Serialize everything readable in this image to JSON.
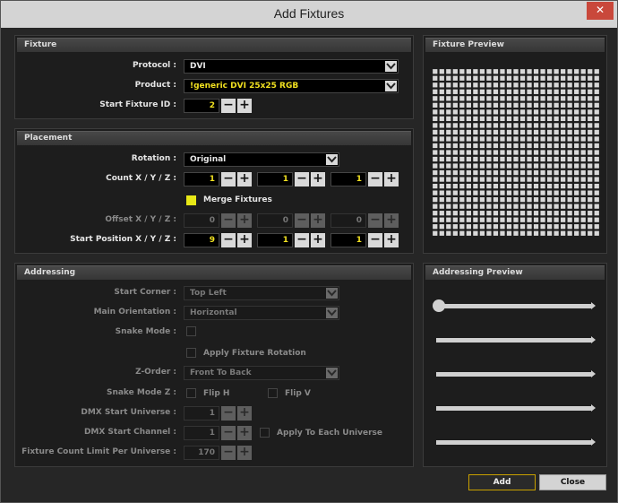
{
  "window": {
    "title": "Add Fixtures",
    "close_glyph": "✕"
  },
  "fixture": {
    "header": "Fixture",
    "protocol_label": "Protocol :",
    "protocol_value": "DVI",
    "product_label": "Product :",
    "product_value": "!generic DVI 25x25 RGB",
    "start_id_label": "Start Fixture ID :",
    "start_id_value": "2"
  },
  "placement": {
    "header": "Placement",
    "rotation_label": "Rotation :",
    "rotation_value": "Original",
    "count_label": "Count X / Y / Z :",
    "count": [
      "1",
      "1",
      "1"
    ],
    "merge_label": "Merge Fixtures",
    "offset_label": "Offset X / Y / Z :",
    "offset": [
      "0",
      "0",
      "0"
    ],
    "start_pos_label": "Start Position X / Y / Z :",
    "start_pos": [
      "9",
      "1",
      "1"
    ]
  },
  "addressing": {
    "header": "Addressing",
    "start_corner_label": "Start Corner :",
    "start_corner_value": "Top Left",
    "main_orient_label": "Main Orientation :",
    "main_orient_value": "Horizontal",
    "snake_label": "Snake Mode :",
    "apply_rot_label": "Apply Fixture Rotation",
    "zorder_label": "Z-Order :",
    "zorder_value": "Front To Back",
    "snake_z_label": "Snake Mode Z :",
    "flip_h_label": "Flip H",
    "flip_v_label": "Flip V",
    "dmx_uni_label": "DMX Start Universe :",
    "dmx_uni_value": "1",
    "dmx_ch_label": "DMX Start Channel :",
    "dmx_ch_value": "1",
    "apply_each_label": "Apply To Each Universe",
    "limit_label": "Fixture Count Limit Per Universe :",
    "limit_value": "170"
  },
  "preview": {
    "header": "Fixture Preview",
    "grid_cols": 25,
    "grid_rows": 25
  },
  "addr_preview": {
    "header": "Addressing Preview"
  },
  "buttons": {
    "add": "Add",
    "close": "Close"
  },
  "colors": {
    "accent": "#e8e817",
    "add_border": "#c8a000"
  }
}
